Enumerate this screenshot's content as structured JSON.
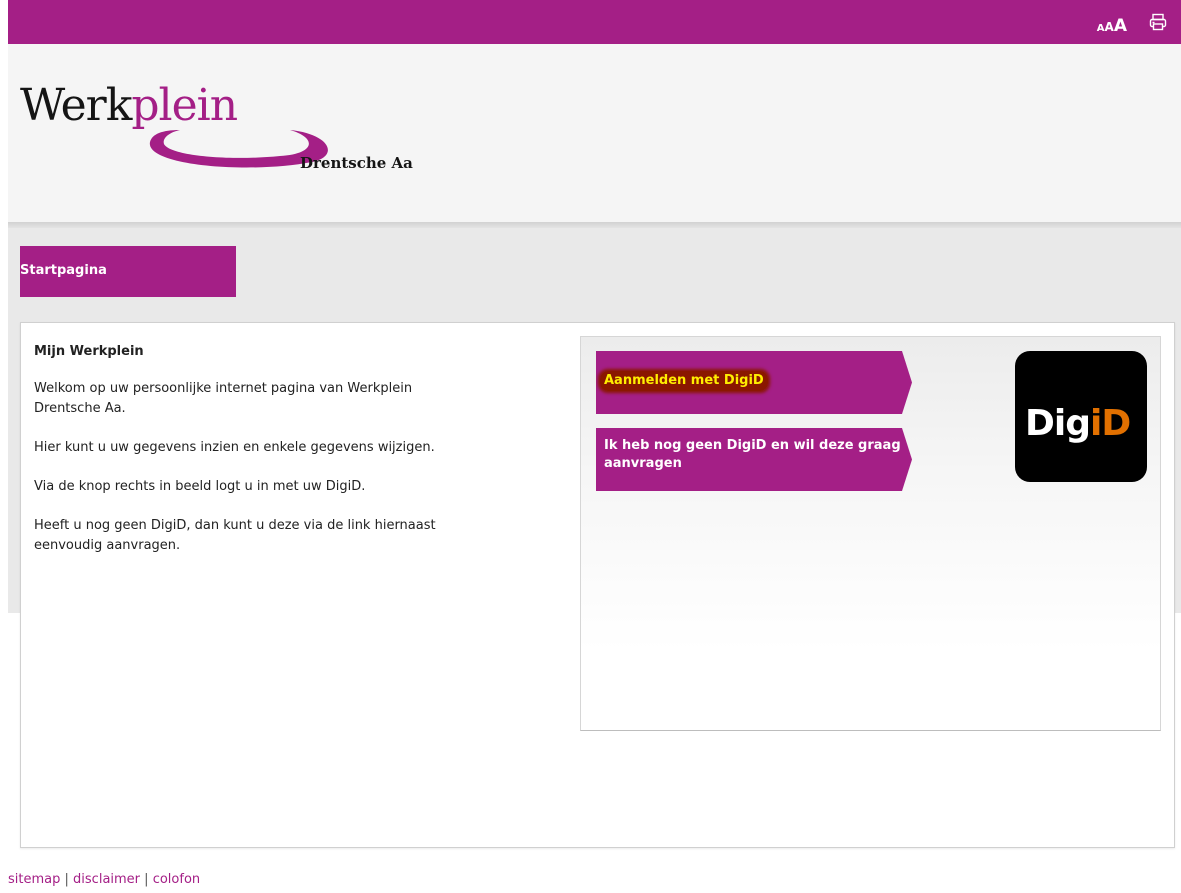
{
  "topbar": {
    "font_sizes": [
      "A",
      "A",
      "A"
    ],
    "print_icon": "printer-icon"
  },
  "logo": {
    "word_black": "Werk",
    "word_purple": "plein",
    "subtitle": "Drentsche Aa"
  },
  "nav": {
    "tabs": [
      {
        "label": "Startpagina"
      }
    ]
  },
  "main": {
    "heading": "Mijn Werkplein",
    "paragraphs": [
      "Welkom op uw persoonlijke internet pagina van Werkplein Drentsche Aa.",
      "Hier kunt u uw gegevens inzien en enkele gegevens wijzigen.",
      "Via de knop rechts in beeld logt u in met uw DigiD.",
      "Heeft u nog geen DigiD, dan kunt u deze via de link hiernaast eenvoudig aanvragen."
    ]
  },
  "login": {
    "login_button": "Aanmelden met DigiD",
    "request_button": "Ik heb nog geen DigiD en wil deze graag aanvragen",
    "logo_text_a": "Dig",
    "logo_text_b": "iD"
  },
  "footer": {
    "links": [
      "sitemap",
      "disclaimer",
      "colofon"
    ],
    "separator": "|"
  },
  "colors": {
    "brand": "#a41f86",
    "highlight_text": "#ffee00",
    "highlight_bg": "#8a1700",
    "digid_accent": "#e17000"
  }
}
